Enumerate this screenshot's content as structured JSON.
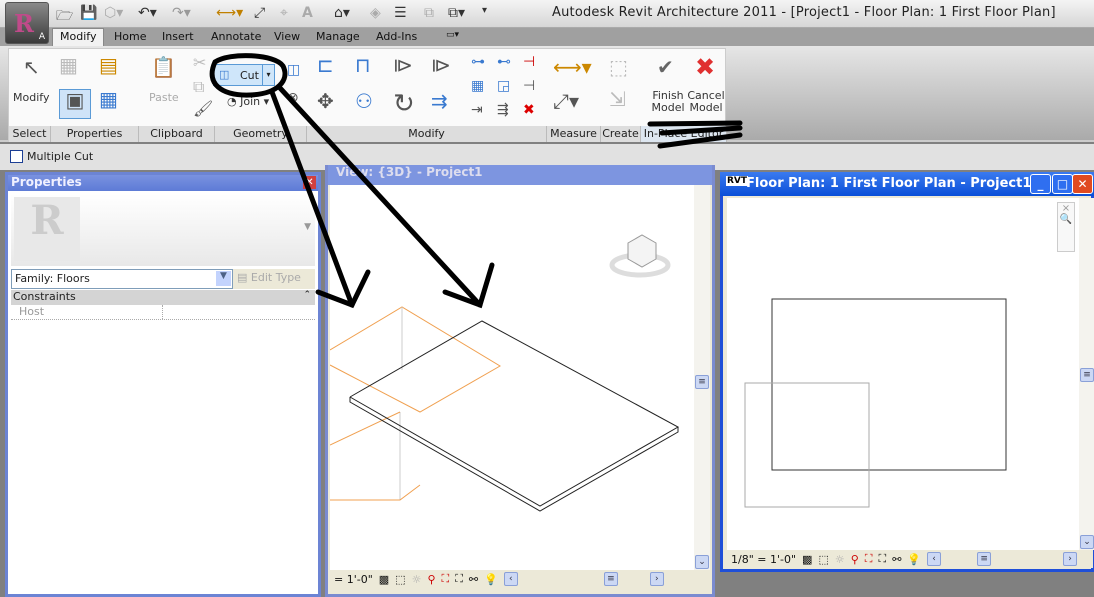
{
  "app": {
    "title": "Autodesk Revit Architecture 2011 - [Project1 - Floor Plan: 1 First Floor Plan]",
    "app_button_letter": "A"
  },
  "tabs": [
    {
      "label": "Modify",
      "active": true
    },
    {
      "label": "Home"
    },
    {
      "label": "Insert"
    },
    {
      "label": "Annotate"
    },
    {
      "label": "View"
    },
    {
      "label": "Manage"
    },
    {
      "label": "Add-Ins"
    }
  ],
  "ribbon": {
    "panels": [
      "Select",
      "Properties",
      "Clipboard",
      "Geometry",
      "Modify",
      "Measure",
      "Create",
      "In-Place Editor"
    ],
    "modify_label": "Modify",
    "paste_label": "Paste",
    "cut_label": "Cut",
    "join_label": "Join",
    "finish_label": "Finish Model",
    "cancel_label": "Cancel Model"
  },
  "options_bar": {
    "multiple_cut_label": "Multiple Cut",
    "multiple_cut_checked": false
  },
  "properties": {
    "title": "Properties",
    "family_select": "Family: Floors",
    "edit_type": "Edit Type",
    "section": "Constraints",
    "rows": [
      {
        "name": "Host",
        "value": ""
      }
    ]
  },
  "view3d": {
    "title": "View: {3D} - Project1",
    "scale": "= 1'-0\""
  },
  "plan": {
    "title": "Floor Plan: 1 First Floor Plan - Project1",
    "scale": "1/8\" = 1'-0\""
  },
  "colors": {
    "selection_orange": "#f0a050",
    "title_blue": "#0a4fd8",
    "annotation": "#000000"
  }
}
